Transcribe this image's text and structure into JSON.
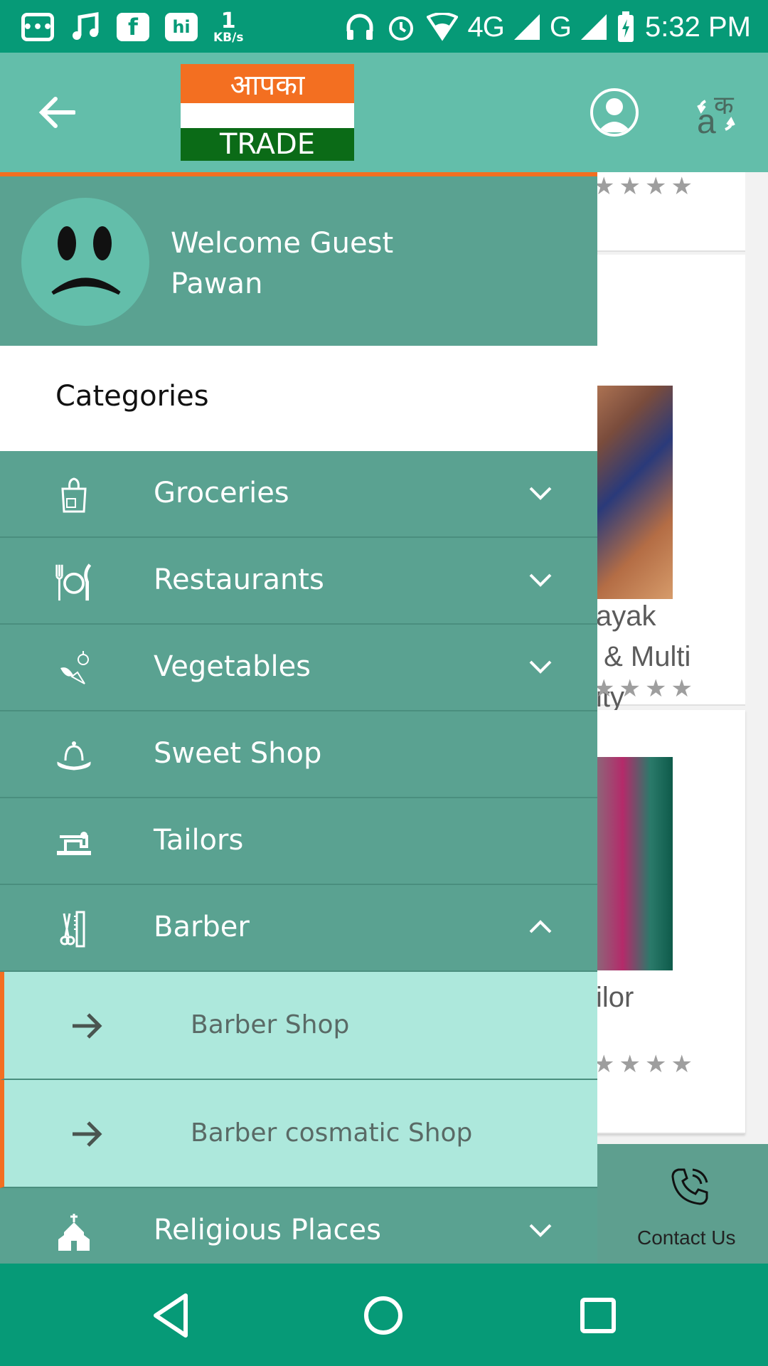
{
  "status_bar": {
    "speed_value": "1",
    "speed_unit": "KB/s",
    "network_4g": "4G",
    "network_g": "G",
    "time": "5:32 PM",
    "icons": [
      "messages-icon",
      "music-icon",
      "facebook-icon",
      "hike-icon",
      "headset-icon",
      "alarm-icon",
      "wifi-icon",
      "signal-icon",
      "battery-icon"
    ]
  },
  "app_bar": {
    "logo_top": "आपका",
    "logo_bottom": "TRADE",
    "lang_icon_a": "a",
    "lang_icon_k": "क",
    "colors": {
      "app_bar": "#63beaa",
      "accent": "#f36f21",
      "logo_green": "#0b6b17"
    }
  },
  "drawer": {
    "welcome_line1": "Welcome Guest",
    "welcome_line2": "Pawan",
    "section_title": "Categories",
    "items": [
      {
        "label": "Groceries",
        "icon": "grocery-bag-icon",
        "chevron": "down"
      },
      {
        "label": "Restaurants",
        "icon": "fork-plate-knife-icon",
        "chevron": "down"
      },
      {
        "label": "Vegetables",
        "icon": "vegetables-icon",
        "chevron": "down"
      },
      {
        "label": "Sweet Shop",
        "icon": "cake-icon",
        "chevron": "none"
      },
      {
        "label": "Tailors",
        "icon": "sewing-machine-icon",
        "chevron": "none"
      },
      {
        "label": "Barber",
        "icon": "comb-scissors-icon",
        "chevron": "up"
      },
      {
        "label": "Religious Places",
        "icon": "church-icon",
        "chevron": "down"
      }
    ],
    "sub_items": [
      {
        "label": "Barber Shop"
      },
      {
        "label": "Barber cosmatic Shop"
      }
    ],
    "colors": {
      "drawer_bg": "#5aa291",
      "sub_item_bg": "#ade8dc"
    }
  },
  "background": {
    "card2_title": "ayak\n & Multi\nity",
    "card3_title": "ilor",
    "contact_label": "Contact Us"
  }
}
